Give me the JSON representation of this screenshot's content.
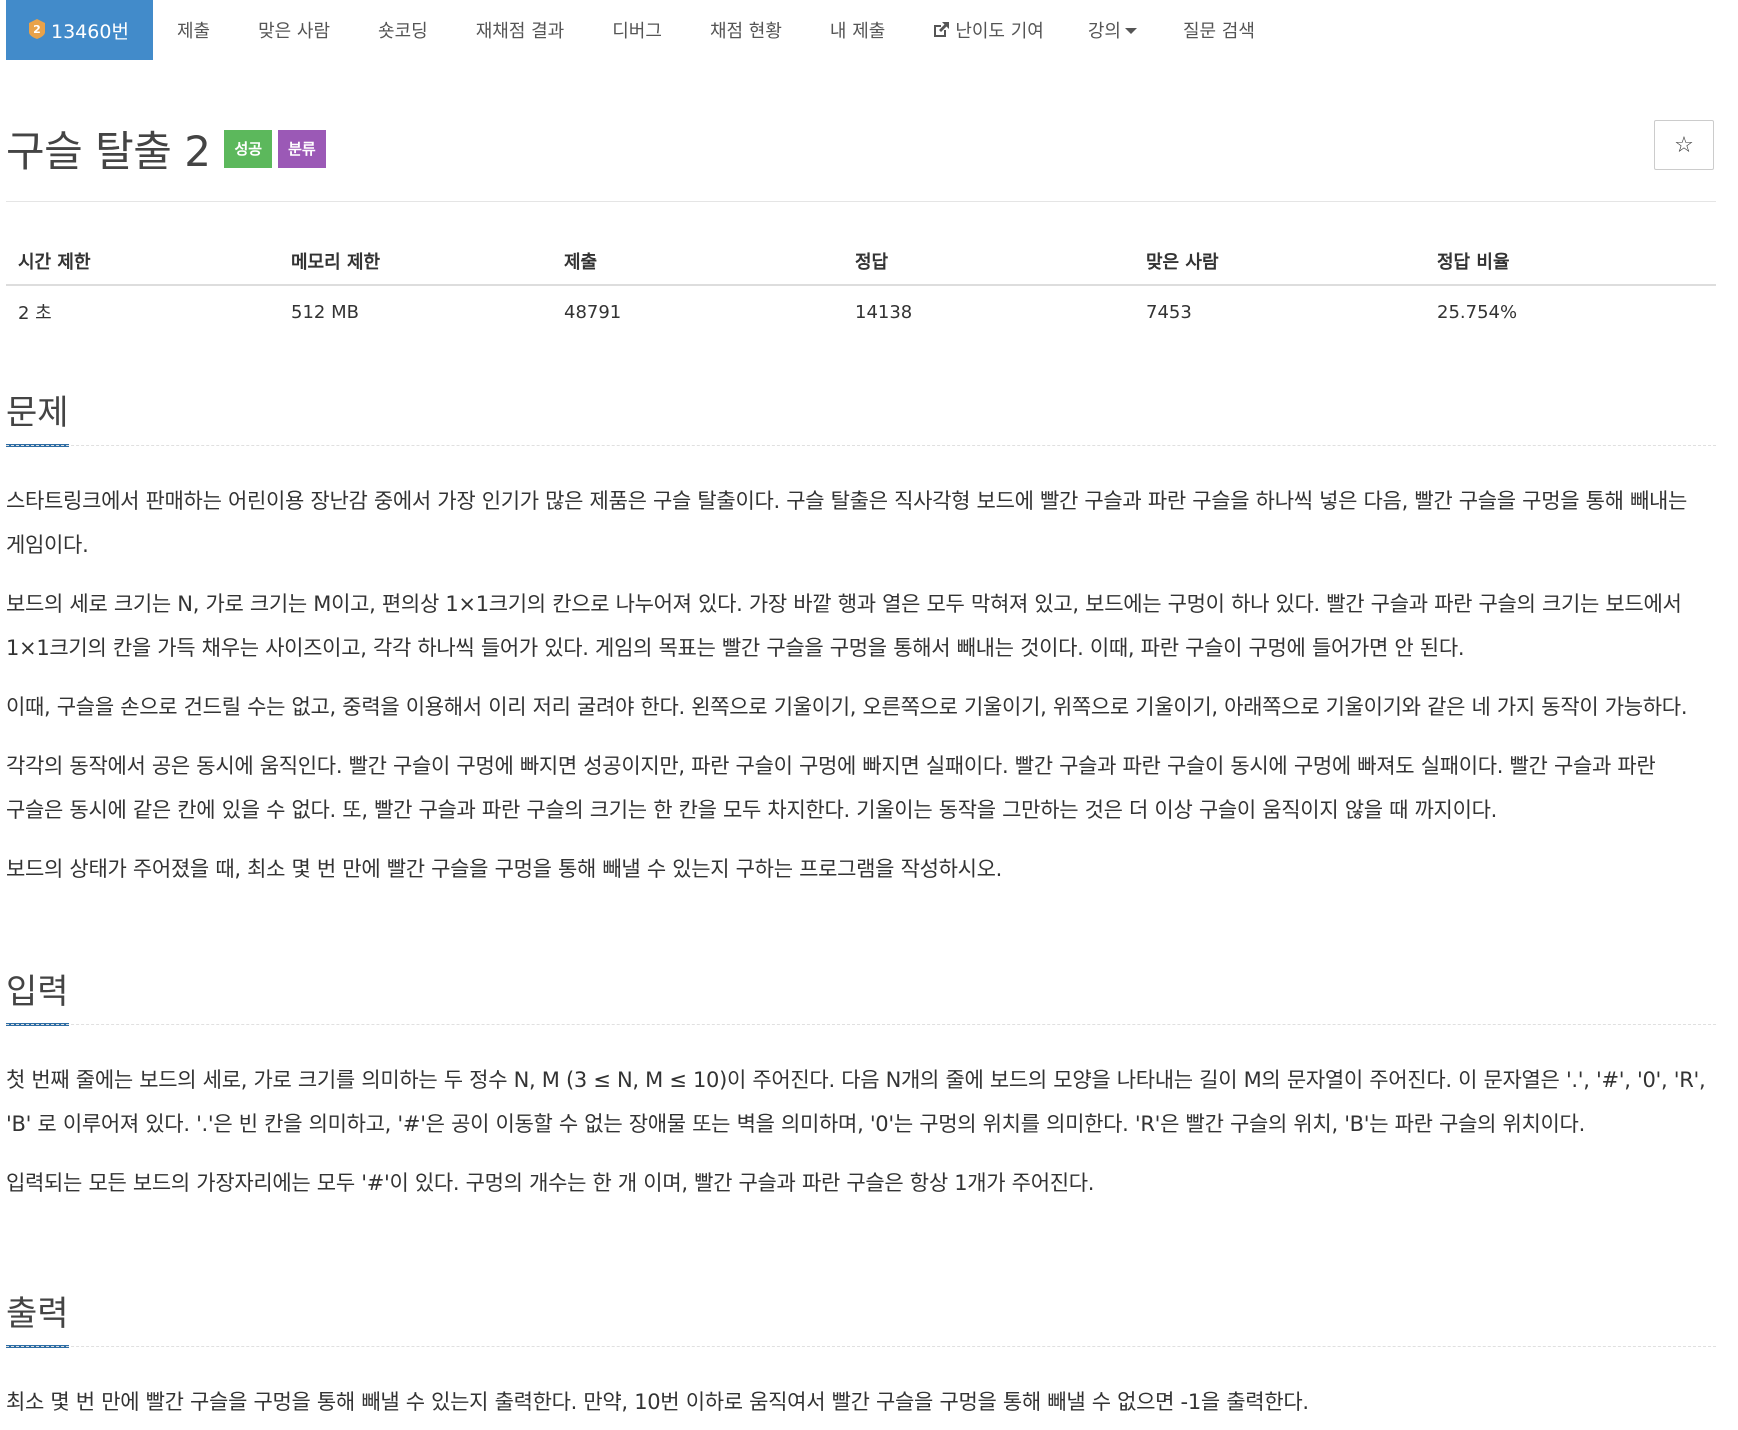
{
  "nav": {
    "problem_number": "13460번",
    "items": [
      "제출",
      "맞은 사람",
      "숏코딩",
      "재채점 결과",
      "디버그",
      "채점 현황",
      "내 제출",
      "난이도 기여",
      "강의",
      "질문 검색"
    ]
  },
  "title": "구슬 탈출 2",
  "badges": {
    "success": "성공",
    "category": "분류"
  },
  "star_label": "☆",
  "stats": {
    "headers": [
      "시간 제한",
      "메모리 제한",
      "제출",
      "정답",
      "맞은 사람",
      "정답 비율"
    ],
    "values": [
      "2 초",
      "512 MB",
      "48791",
      "14138",
      "7453",
      "25.754%"
    ]
  },
  "sections": {
    "problem": {
      "heading": "문제",
      "p1": "스타트링크에서 판매하는 어린이용 장난감 중에서 가장 인기가 많은 제품은 구슬 탈출이다. 구슬 탈출은 직사각형 보드에 빨간 구슬과 파란 구슬을 하나씩 넣은 다음, 빨간 구슬을 구멍을 통해 빼내는 게임이다.",
      "p2": "보드의 세로 크기는 N, 가로 크기는 M이고, 편의상 1×1크기의 칸으로 나누어져 있다. 가장 바깥 행과 열은 모두 막혀져 있고, 보드에는 구멍이 하나 있다. 빨간 구슬과 파란 구슬의 크기는 보드에서 1×1크기의 칸을 가득 채우는 사이즈이고, 각각 하나씩 들어가 있다. 게임의 목표는 빨간 구슬을 구멍을 통해서 빼내는 것이다. 이때, 파란 구슬이 구멍에 들어가면 안 된다.",
      "p3": "이때, 구슬을 손으로 건드릴 수는 없고, 중력을 이용해서 이리 저리 굴려야 한다. 왼쪽으로 기울이기, 오른쪽으로 기울이기, 위쪽으로 기울이기, 아래쪽으로 기울이기와 같은 네 가지 동작이 가능하다.",
      "p4": "각각의 동작에서 공은 동시에 움직인다. 빨간 구슬이 구멍에 빠지면 성공이지만, 파란 구슬이 구멍에 빠지면 실패이다. 빨간 구슬과 파란 구슬이 동시에 구멍에 빠져도 실패이다. 빨간 구슬과 파란 구슬은 동시에 같은 칸에 있을 수 없다. 또, 빨간 구슬과 파란 구슬의 크기는 한 칸을 모두 차지한다. 기울이는 동작을 그만하는 것은 더 이상 구슬이 움직이지 않을 때 까지이다.",
      "p5": "보드의 상태가 주어졌을 때, 최소 몇 번 만에 빨간 구슬을 구멍을 통해 빼낼 수 있는지 구하는 프로그램을 작성하시오."
    },
    "input": {
      "heading": "입력",
      "p1": "첫 번째 줄에는 보드의 세로, 가로 크기를 의미하는 두 정수 N, M (3 ≤ N, M ≤ 10)이 주어진다. 다음 N개의 줄에 보드의 모양을 나타내는 길이 M의 문자열이 주어진다. 이 문자열은 '.', '#', '0', 'R', 'B' 로 이루어져 있다. '.'은 빈 칸을 의미하고, '#'은 공이 이동할 수 없는 장애물 또는 벽을 의미하며, '0'는 구멍의 위치를 의미한다. 'R'은 빨간 구슬의 위치, 'B'는 파란 구슬의 위치이다.",
      "p2": "입력되는 모든 보드의 가장자리에는 모두 '#'이 있다. 구멍의 개수는 한 개 이며, 빨간 구슬과 파란 구슬은 항상 1개가 주어진다."
    },
    "output": {
      "heading": "출력",
      "p1": "최소 몇 번 만에 빨간 구슬을 구멍을 통해 빼낼 수 있는지 출력한다. 만약, 10번 이하로 움직여서 빨간 구슬을 구멍을 통해 빼낼 수 없으면 -1을 출력한다."
    }
  }
}
